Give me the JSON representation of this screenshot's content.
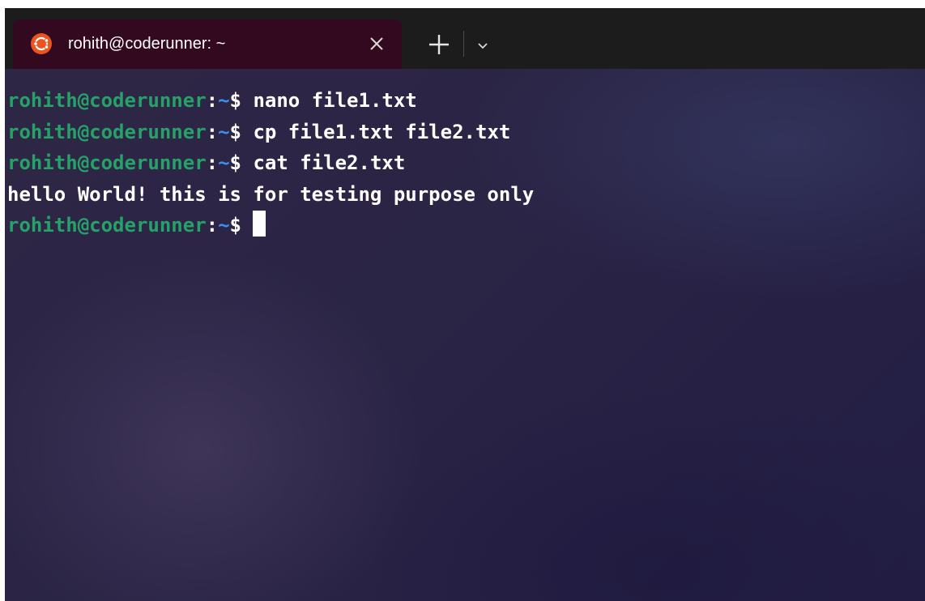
{
  "window": {
    "tab": {
      "title": "rohith@coderunner: ~",
      "icon": "ubuntu-logo-icon",
      "close_icon": "close-icon"
    },
    "new_tab_icon": "plus-icon",
    "dropdown_icon": "chevron-down-icon"
  },
  "colors": {
    "prompt_user": "#26a269",
    "prompt_path": "#3b8eea",
    "tab_background": "#33091f",
    "ubuntu_orange": "#e95420"
  },
  "terminal": {
    "prompt": {
      "user_host": "rohith@coderunner",
      "colon": ":",
      "path": "~",
      "symbol": "$"
    },
    "lines": [
      {
        "type": "command",
        "text": "nano file1.txt"
      },
      {
        "type": "command",
        "text": "cp file1.txt file2.txt"
      },
      {
        "type": "command",
        "text": "cat file2.txt"
      },
      {
        "type": "output",
        "text": "hello World! this is for testing purpose only"
      },
      {
        "type": "prompt",
        "text": ""
      }
    ]
  }
}
